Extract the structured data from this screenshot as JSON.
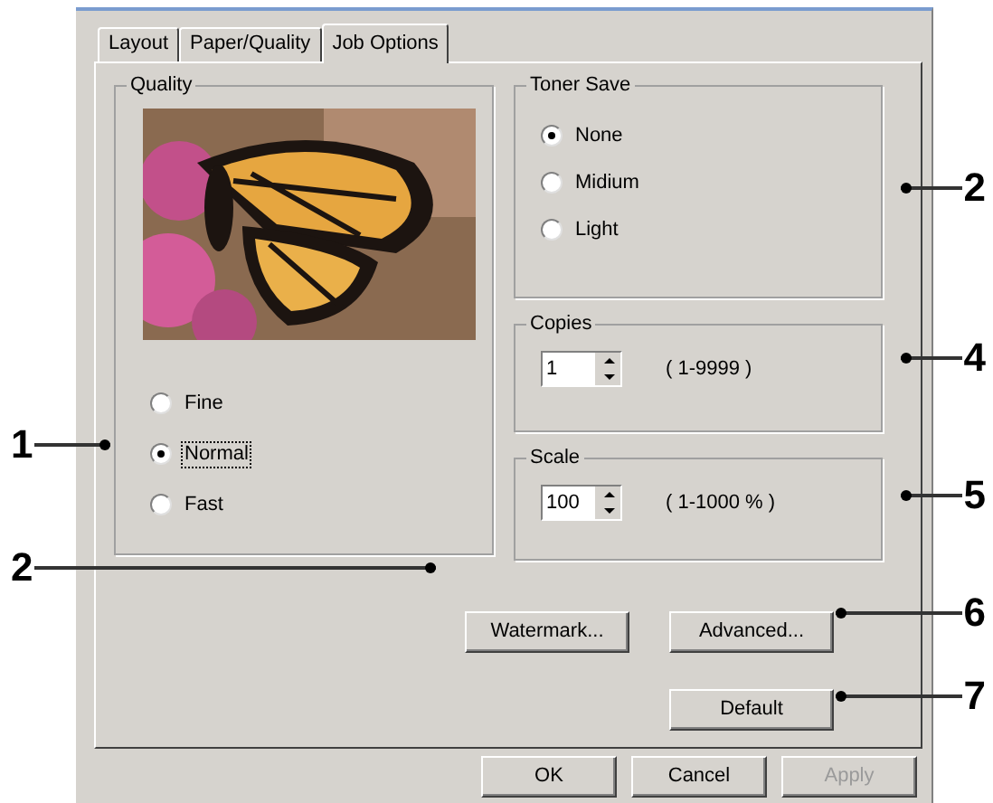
{
  "tabs": [
    {
      "label": "Layout",
      "selected": false
    },
    {
      "label": "Paper/Quality",
      "selected": false
    },
    {
      "label": "Job Options",
      "selected": true
    }
  ],
  "quality": {
    "title": "Quality",
    "options": [
      {
        "label": "Fine",
        "selected": false,
        "focused": false
      },
      {
        "label": "Normal",
        "selected": true,
        "focused": true
      },
      {
        "label": "Fast",
        "selected": false,
        "focused": false
      }
    ]
  },
  "toner_save": {
    "title": "Toner Save",
    "options": [
      {
        "label": "None",
        "selected": true
      },
      {
        "label": "Midium",
        "selected": false
      },
      {
        "label": "Light",
        "selected": false
      }
    ]
  },
  "copies": {
    "title": "Copies",
    "value": "1",
    "range": "( 1-9999 )"
  },
  "scale": {
    "title": "Scale",
    "value": "100",
    "range": "( 1-1000 % )"
  },
  "buttons": [
    {
      "label": "Watermark..."
    },
    {
      "label": "Advanced..."
    },
    {
      "label": "Default"
    }
  ],
  "dialog_buttons": [
    {
      "label": "OK",
      "disabled": false
    },
    {
      "label": "Cancel",
      "disabled": false
    },
    {
      "label": "Apply",
      "disabled": true
    }
  ],
  "callouts": [
    {
      "label": "1",
      "kind": "left"
    },
    {
      "label": "2",
      "kind": "left"
    },
    {
      "label": "2",
      "kind": "right"
    },
    {
      "label": "4",
      "kind": "right"
    },
    {
      "label": "5",
      "kind": "right"
    },
    {
      "label": "6",
      "kind": "right"
    },
    {
      "label": "7",
      "kind": "right"
    }
  ]
}
